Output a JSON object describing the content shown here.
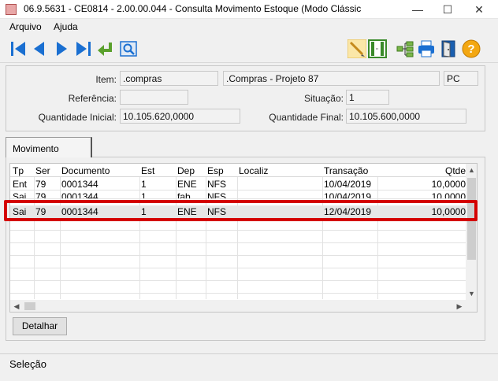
{
  "window": {
    "title": "06.9.5631 - CE0814 - 2.00.00.044 - Consulta Movimento Estoque (Modo Clássic"
  },
  "menu": [
    {
      "label": "Arquivo"
    },
    {
      "label": "Ajuda"
    }
  ],
  "header": {
    "item_label": "Item:",
    "item_code": ".compras",
    "item_desc": ".Compras - Projeto 87",
    "item_unit": "PC",
    "referencia_label": "Referência:",
    "referencia_value": "",
    "situacao_label": "Situação:",
    "situacao_value": "1",
    "qtd_inicial_label": "Quantidade Inicial:",
    "qtd_inicial_value": "10.105.620,0000",
    "qtd_final_label": "Quantidade Final:",
    "qtd_final_value": "10.105.600,0000"
  },
  "tab": {
    "label": "Movimento"
  },
  "grid": {
    "columns": [
      "Tp",
      "Ser",
      "Documento",
      "Est",
      "Dep",
      "Esp",
      "Localiz",
      "Transação",
      "Qtde"
    ],
    "rows": [
      [
        "Ent",
        "79",
        "0001344",
        "1",
        "ENE",
        "NFS",
        "",
        "10/04/2019",
        "10,0000"
      ],
      [
        "Sai",
        "79",
        "0001344",
        "1",
        "fab",
        "NFS",
        "",
        "10/04/2019",
        "10,0000"
      ],
      [
        "Sai",
        "79",
        "0001344",
        "1",
        "ENE",
        "NFS",
        "",
        "12/04/2019",
        "10,0000"
      ]
    ],
    "selected_row": 2
  },
  "buttons": {
    "detalhar": "Detalhar"
  },
  "status": {
    "text": "Seleção"
  },
  "colors": {
    "highlight": "#d40000",
    "nav_blue": "#1a6fd1"
  }
}
